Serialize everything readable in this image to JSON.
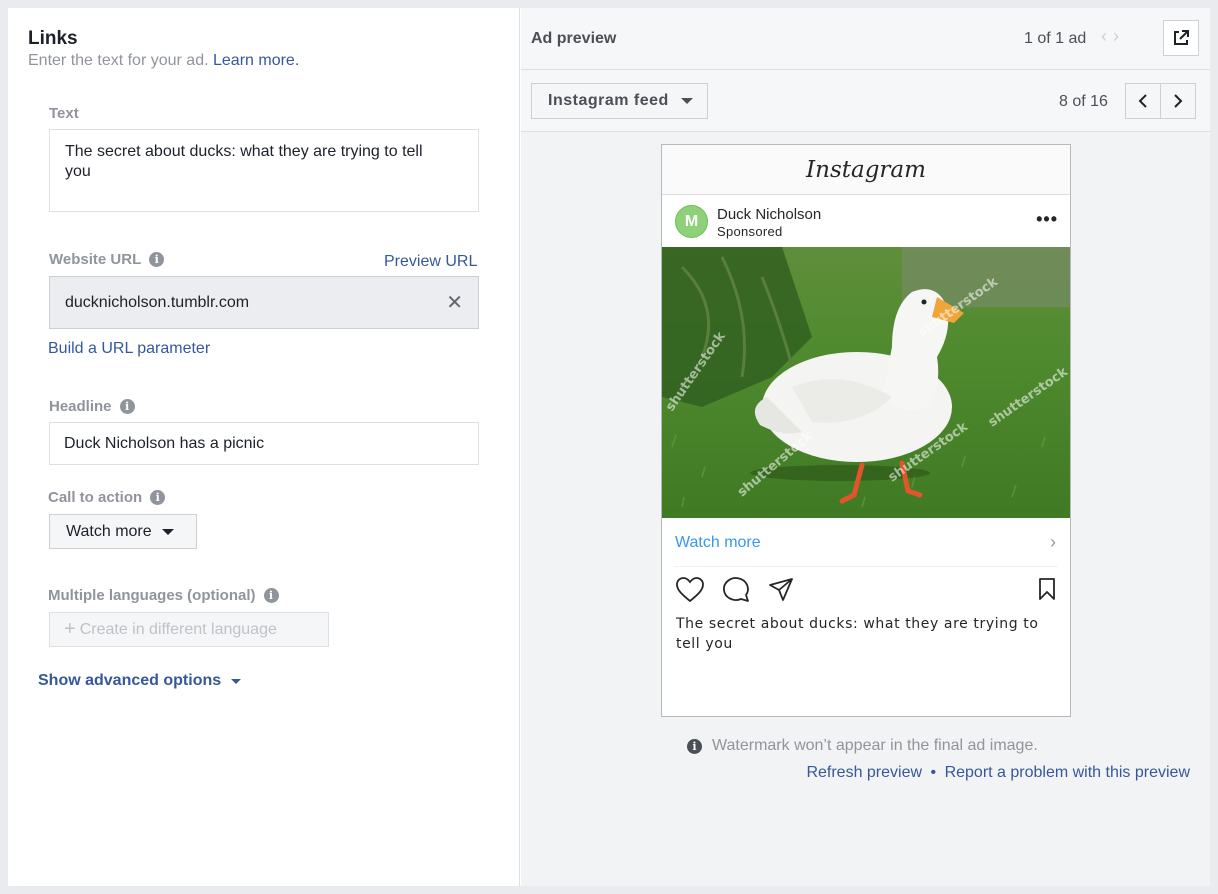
{
  "links_panel": {
    "title": "Links",
    "subtitle": "Enter the text for your ad.",
    "learn_more": "Learn more.",
    "text_label": "Text",
    "text_value": "The secret about ducks: what they are trying to tell you",
    "website_url_label": "Website URL",
    "preview_url": "Preview URL",
    "website_url_value": "ducknicholson.tumblr.com",
    "build_url_param": "Build a URL parameter",
    "headline_label": "Headline",
    "headline_value": "Duck Nicholson has a picnic",
    "cta_label": "Call to action",
    "cta_value": "Watch more",
    "languages_label": "Multiple languages (optional)",
    "create_language": "Create in different language",
    "advanced": "Show advanced options"
  },
  "preview_panel": {
    "title": "Ad preview",
    "ad_count": "1 of 1 ad",
    "placement": "Instagram feed",
    "page_count": "8 of 16",
    "instagram_logo": "Instagram",
    "avatar_letter": "M",
    "username": "Duck Nicholson",
    "sponsored": "Sponsored",
    "image_watermark": "shutterstock",
    "cta_text": "Watch more",
    "caption": "The secret about ducks: what they are trying to tell you",
    "watermark_note": "Watermark won’t appear in the final ad image.",
    "refresh_preview": "Refresh preview",
    "separator": "•",
    "report_problem": "Report a problem with this preview"
  },
  "colors": {
    "link": "#365899",
    "ig_link": "#3897f0",
    "avatar": "#8fd17a",
    "grass": "#4f8a2e"
  }
}
